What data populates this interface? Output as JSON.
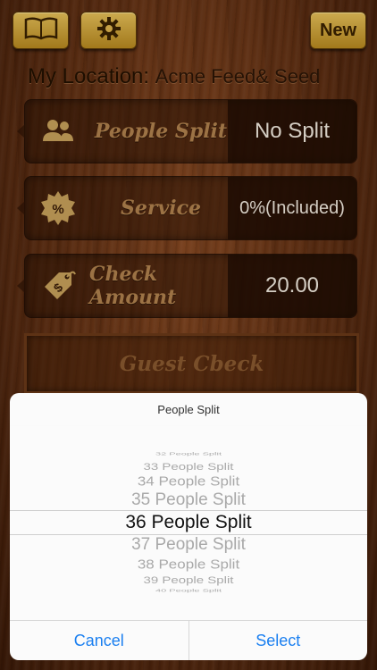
{
  "toolbar": {
    "book_icon": "book-icon",
    "settings_icon": "gear-icon",
    "new_label": "New"
  },
  "location": {
    "label": "My Location:",
    "name": "Acme Feed& Seed"
  },
  "rows": [
    {
      "icon": "people-icon",
      "label": "People Split",
      "value": "No Split"
    },
    {
      "icon": "percent-badge-icon",
      "label": "Service",
      "value": "0%(Included)"
    },
    {
      "icon": "price-tag-icon",
      "label": "Check Amount",
      "value": "20.00"
    }
  ],
  "guest_check": {
    "label": "Guest Cbeck"
  },
  "picker_sheet": {
    "title": "People Split",
    "options": [
      "32 People Split",
      "33 People Split",
      "34 People Split",
      "35 People Split",
      "36 People Split",
      "37 People Split",
      "38 People Split",
      "39 People Split",
      "40 People Split"
    ],
    "selected": "36 People Split",
    "cancel_label": "Cancel",
    "select_label": "Select"
  },
  "colors": {
    "gold_button": "#d9ab3a",
    "wood": "#6b3515",
    "ios_blue": "#1a7ff0"
  }
}
